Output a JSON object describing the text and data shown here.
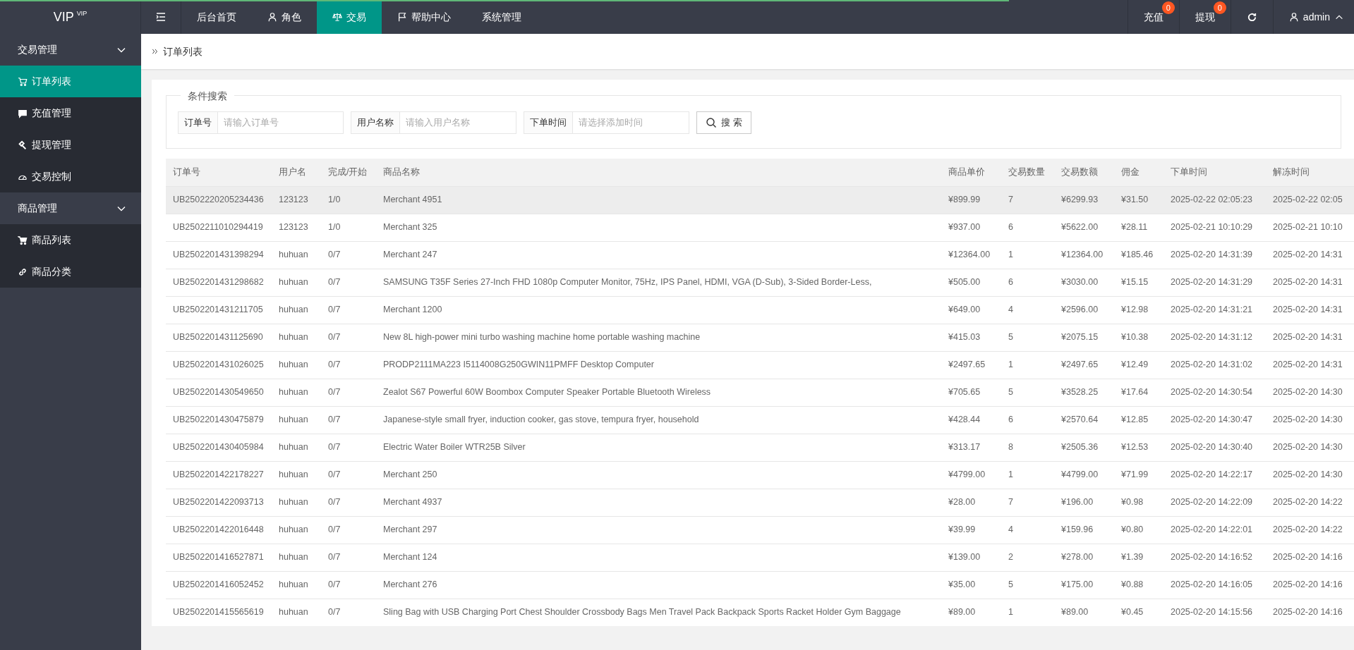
{
  "logo": {
    "text": "VIP",
    "sup": "VIP"
  },
  "loading_bar": {
    "level": 0.745
  },
  "top_nav": [
    {
      "kind": "toggle",
      "selected": false
    },
    {
      "kind": "link",
      "label": "后台首页",
      "selected": false
    },
    {
      "kind": "link",
      "label": "角色",
      "selected": false
    },
    {
      "kind": "link",
      "label": "交易",
      "selected": true
    },
    {
      "kind": "link",
      "label": "帮助中心",
      "selected": false
    },
    {
      "kind": "link",
      "label": "系统管理",
      "selected": false
    }
  ],
  "top_right": [
    {
      "kind": "badge",
      "label": "充值",
      "badge": "0"
    },
    {
      "kind": "badge",
      "label": "提现",
      "badge": "0"
    },
    {
      "kind": "refresh"
    },
    {
      "kind": "user",
      "label": "admin"
    }
  ],
  "sidebar": [
    {
      "label": "交易管理",
      "expanded": true,
      "items": [
        {
          "label": "订单列表",
          "selected": true
        },
        {
          "label": "充值管理",
          "selected": false
        },
        {
          "label": "提现管理",
          "selected": false
        },
        {
          "label": "交易控制",
          "selected": false
        }
      ]
    },
    {
      "label": "商品管理",
      "expanded": true,
      "items": [
        {
          "label": "商品列表",
          "selected": false
        },
        {
          "label": "商品分类",
          "selected": false
        }
      ]
    }
  ],
  "breadcrumb": [
    "订单列表"
  ],
  "search": {
    "legend": "条件搜索",
    "fields": [
      {
        "label": "订单号",
        "placeholder": "请输入订单号"
      },
      {
        "label": "用户名称",
        "placeholder": "请输入用户名称"
      },
      {
        "label": "下单时间",
        "placeholder": "请选择添加时间"
      }
    ],
    "button": "搜 索"
  },
  "table": {
    "columns": [
      "订单号",
      "用户名",
      "完成/开始",
      "商品名称",
      "商品单价",
      "交易数量",
      "交易数额",
      "佣金",
      "下单时间",
      "解冻时间"
    ],
    "rows": [
      {
        "highlighted": true,
        "cells": [
          "UB2502220205234436",
          "123123",
          "1/0",
          "Merchant 4951",
          "¥899.99",
          "7",
          "¥6299.93",
          "¥31.50",
          "2025-02-22 02:05:23",
          "2025-02-22 02:05"
        ]
      },
      {
        "highlighted": false,
        "cells": [
          "UB2502211010294419",
          "123123",
          "1/0",
          "Merchant 325",
          "¥937.00",
          "6",
          "¥5622.00",
          "¥28.11",
          "2025-02-21 10:10:29",
          "2025-02-21 10:10"
        ]
      },
      {
        "highlighted": false,
        "cells": [
          "UB2502201431398294",
          "huhuan",
          "0/7",
          "Merchant 247",
          "¥12364.00",
          "1",
          "¥12364.00",
          "¥185.46",
          "2025-02-20 14:31:39",
          "2025-02-20 14:31"
        ]
      },
      {
        "highlighted": false,
        "cells": [
          "UB2502201431298682",
          "huhuan",
          "0/7",
          "SAMSUNG T35F Series 27-Inch FHD 1080p Computer Monitor, 75Hz, IPS Panel, HDMI, VGA (D-Sub), 3-Sided Border-Less,",
          "¥505.00",
          "6",
          "¥3030.00",
          "¥15.15",
          "2025-02-20 14:31:29",
          "2025-02-20 14:31"
        ]
      },
      {
        "highlighted": false,
        "cells": [
          "UB2502201431211705",
          "huhuan",
          "0/7",
          "Merchant 1200",
          "¥649.00",
          "4",
          "¥2596.00",
          "¥12.98",
          "2025-02-20 14:31:21",
          "2025-02-20 14:31"
        ]
      },
      {
        "highlighted": false,
        "cells": [
          "UB2502201431125690",
          "huhuan",
          "0/7",
          "New 8L high-power mini turbo washing machine home portable washing machine",
          "¥415.03",
          "5",
          "¥2075.15",
          "¥10.38",
          "2025-02-20 14:31:12",
          "2025-02-20 14:31"
        ]
      },
      {
        "highlighted": false,
        "cells": [
          "UB2502201431026025",
          "huhuan",
          "0/7",
          "PRODP2111MA223 I5114008G250GWIN11PMFF Desktop Computer",
          "¥2497.65",
          "1",
          "¥2497.65",
          "¥12.49",
          "2025-02-20 14:31:02",
          "2025-02-20 14:31"
        ]
      },
      {
        "highlighted": false,
        "cells": [
          "UB2502201430549650",
          "huhuan",
          "0/7",
          "Zealot S67 Powerful 60W Boombox Computer Speaker Portable Bluetooth Wireless",
          "¥705.65",
          "5",
          "¥3528.25",
          "¥17.64",
          "2025-02-20 14:30:54",
          "2025-02-20 14:30"
        ]
      },
      {
        "highlighted": false,
        "cells": [
          "UB2502201430475879",
          "huhuan",
          "0/7",
          "Japanese-style small fryer, induction cooker, gas stove, tempura fryer, household",
          "¥428.44",
          "6",
          "¥2570.64",
          "¥12.85",
          "2025-02-20 14:30:47",
          "2025-02-20 14:30"
        ]
      },
      {
        "highlighted": false,
        "cells": [
          "UB2502201430405984",
          "huhuan",
          "0/7",
          "Electric Water Boiler WTR25B Silver",
          "¥313.17",
          "8",
          "¥2505.36",
          "¥12.53",
          "2025-02-20 14:30:40",
          "2025-02-20 14:30"
        ]
      },
      {
        "highlighted": false,
        "cells": [
          "UB2502201422178227",
          "huhuan",
          "0/7",
          "Merchant 250",
          "¥4799.00",
          "1",
          "¥4799.00",
          "¥71.99",
          "2025-02-20 14:22:17",
          "2025-02-20 14:30"
        ]
      },
      {
        "highlighted": false,
        "cells": [
          "UB2502201422093713",
          "huhuan",
          "0/7",
          "Merchant 4937",
          "¥28.00",
          "7",
          "¥196.00",
          "¥0.98",
          "2025-02-20 14:22:09",
          "2025-02-20 14:22"
        ]
      },
      {
        "highlighted": false,
        "cells": [
          "UB2502201422016448",
          "huhuan",
          "0/7",
          "Merchant 297",
          "¥39.99",
          "4",
          "¥159.96",
          "¥0.80",
          "2025-02-20 14:22:01",
          "2025-02-20 14:22"
        ]
      },
      {
        "highlighted": false,
        "cells": [
          "UB2502201416527871",
          "huhuan",
          "0/7",
          "Merchant 124",
          "¥139.00",
          "2",
          "¥278.00",
          "¥1.39",
          "2025-02-20 14:16:52",
          "2025-02-20 14:16"
        ]
      },
      {
        "highlighted": false,
        "cells": [
          "UB2502201416052452",
          "huhuan",
          "0/7",
          "Merchant 276",
          "¥35.00",
          "5",
          "¥175.00",
          "¥0.88",
          "2025-02-20 14:16:05",
          "2025-02-20 14:16"
        ]
      },
      {
        "highlighted": false,
        "cells": [
          "UB2502201415565619",
          "huhuan",
          "0/7",
          "Sling Bag with USB Charging Port Chest Shoulder Crossbody Bags Men Travel Pack Backpack Sports Racket Holder Gym Baggage",
          "¥89.00",
          "1",
          "¥89.00",
          "¥0.45",
          "2025-02-20 14:15:56",
          "2025-02-20 14:16"
        ]
      }
    ]
  }
}
